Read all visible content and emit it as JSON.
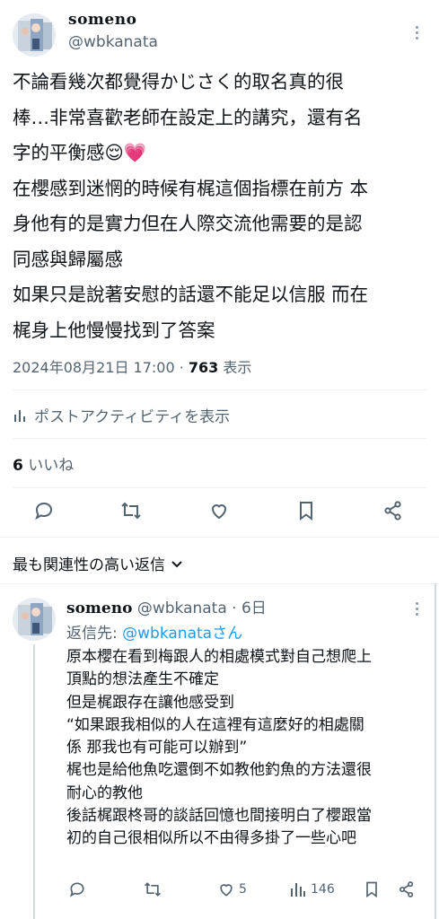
{
  "tweet": {
    "author_name": "someno",
    "author_handle": "@wbkanata",
    "lines": [
      "不論看幾次都覺得かじさく的取名真的很",
      "棒…非常喜歡老師在設定上的講究，還有名",
      "字的平衡感😌💗",
      "在櫻感到迷惘的時候有梶這個指標在前方 本",
      "身他有的是實力但在人際交流他需要的是認",
      "同感與歸屬感",
      "如果只是說著安慰的話還不能足以信服 而在",
      "梶身上他慢慢找到了答案"
    ],
    "timestamp": "2024年08月21日 17:00",
    "separator": " · ",
    "views_count": "763",
    "views_label": " 表示",
    "activity_label": "ポストアクティビティを表示",
    "likes_count": "6",
    "likes_label": " いいね"
  },
  "sort": {
    "label": "最も関連性の高い返信",
    "chevron": "⌄"
  },
  "reply": {
    "author_name": "someno",
    "author_handle": " @wbkanata",
    "time": " · 6日",
    "reply_to_prefix": "返信先: ",
    "reply_to_mention": "@wbkanataさん",
    "lines": [
      "原本櫻在看到梅跟人的相處模式對自己想爬上",
      "頂點的想法產生不確定",
      "但是梶跟存在讓他感受到",
      "“如果跟我相似的人在這裡有這麼好的相處關",
      "係 那我也有可能可以辦到”",
      "梶也是給他魚吃還倒不如教他釣魚的方法還很",
      "耐心的教他",
      "後話梶跟柊哥的談話回憶也間接明白了櫻跟當",
      "初的自己很相似所以不由得多掛了一些心吧"
    ],
    "likes": "5",
    "views": "146"
  },
  "icons": {
    "reply": "reply-icon",
    "retweet": "retweet-icon",
    "like": "heart-icon",
    "bookmark": "bookmark-icon",
    "share": "share-icon",
    "analytics": "analytics-icon",
    "more": "more-icon"
  },
  "colors": {
    "text": "#0f1419",
    "secondary": "#536471",
    "link": "#1d9bf0",
    "divider": "#eff3f4"
  }
}
